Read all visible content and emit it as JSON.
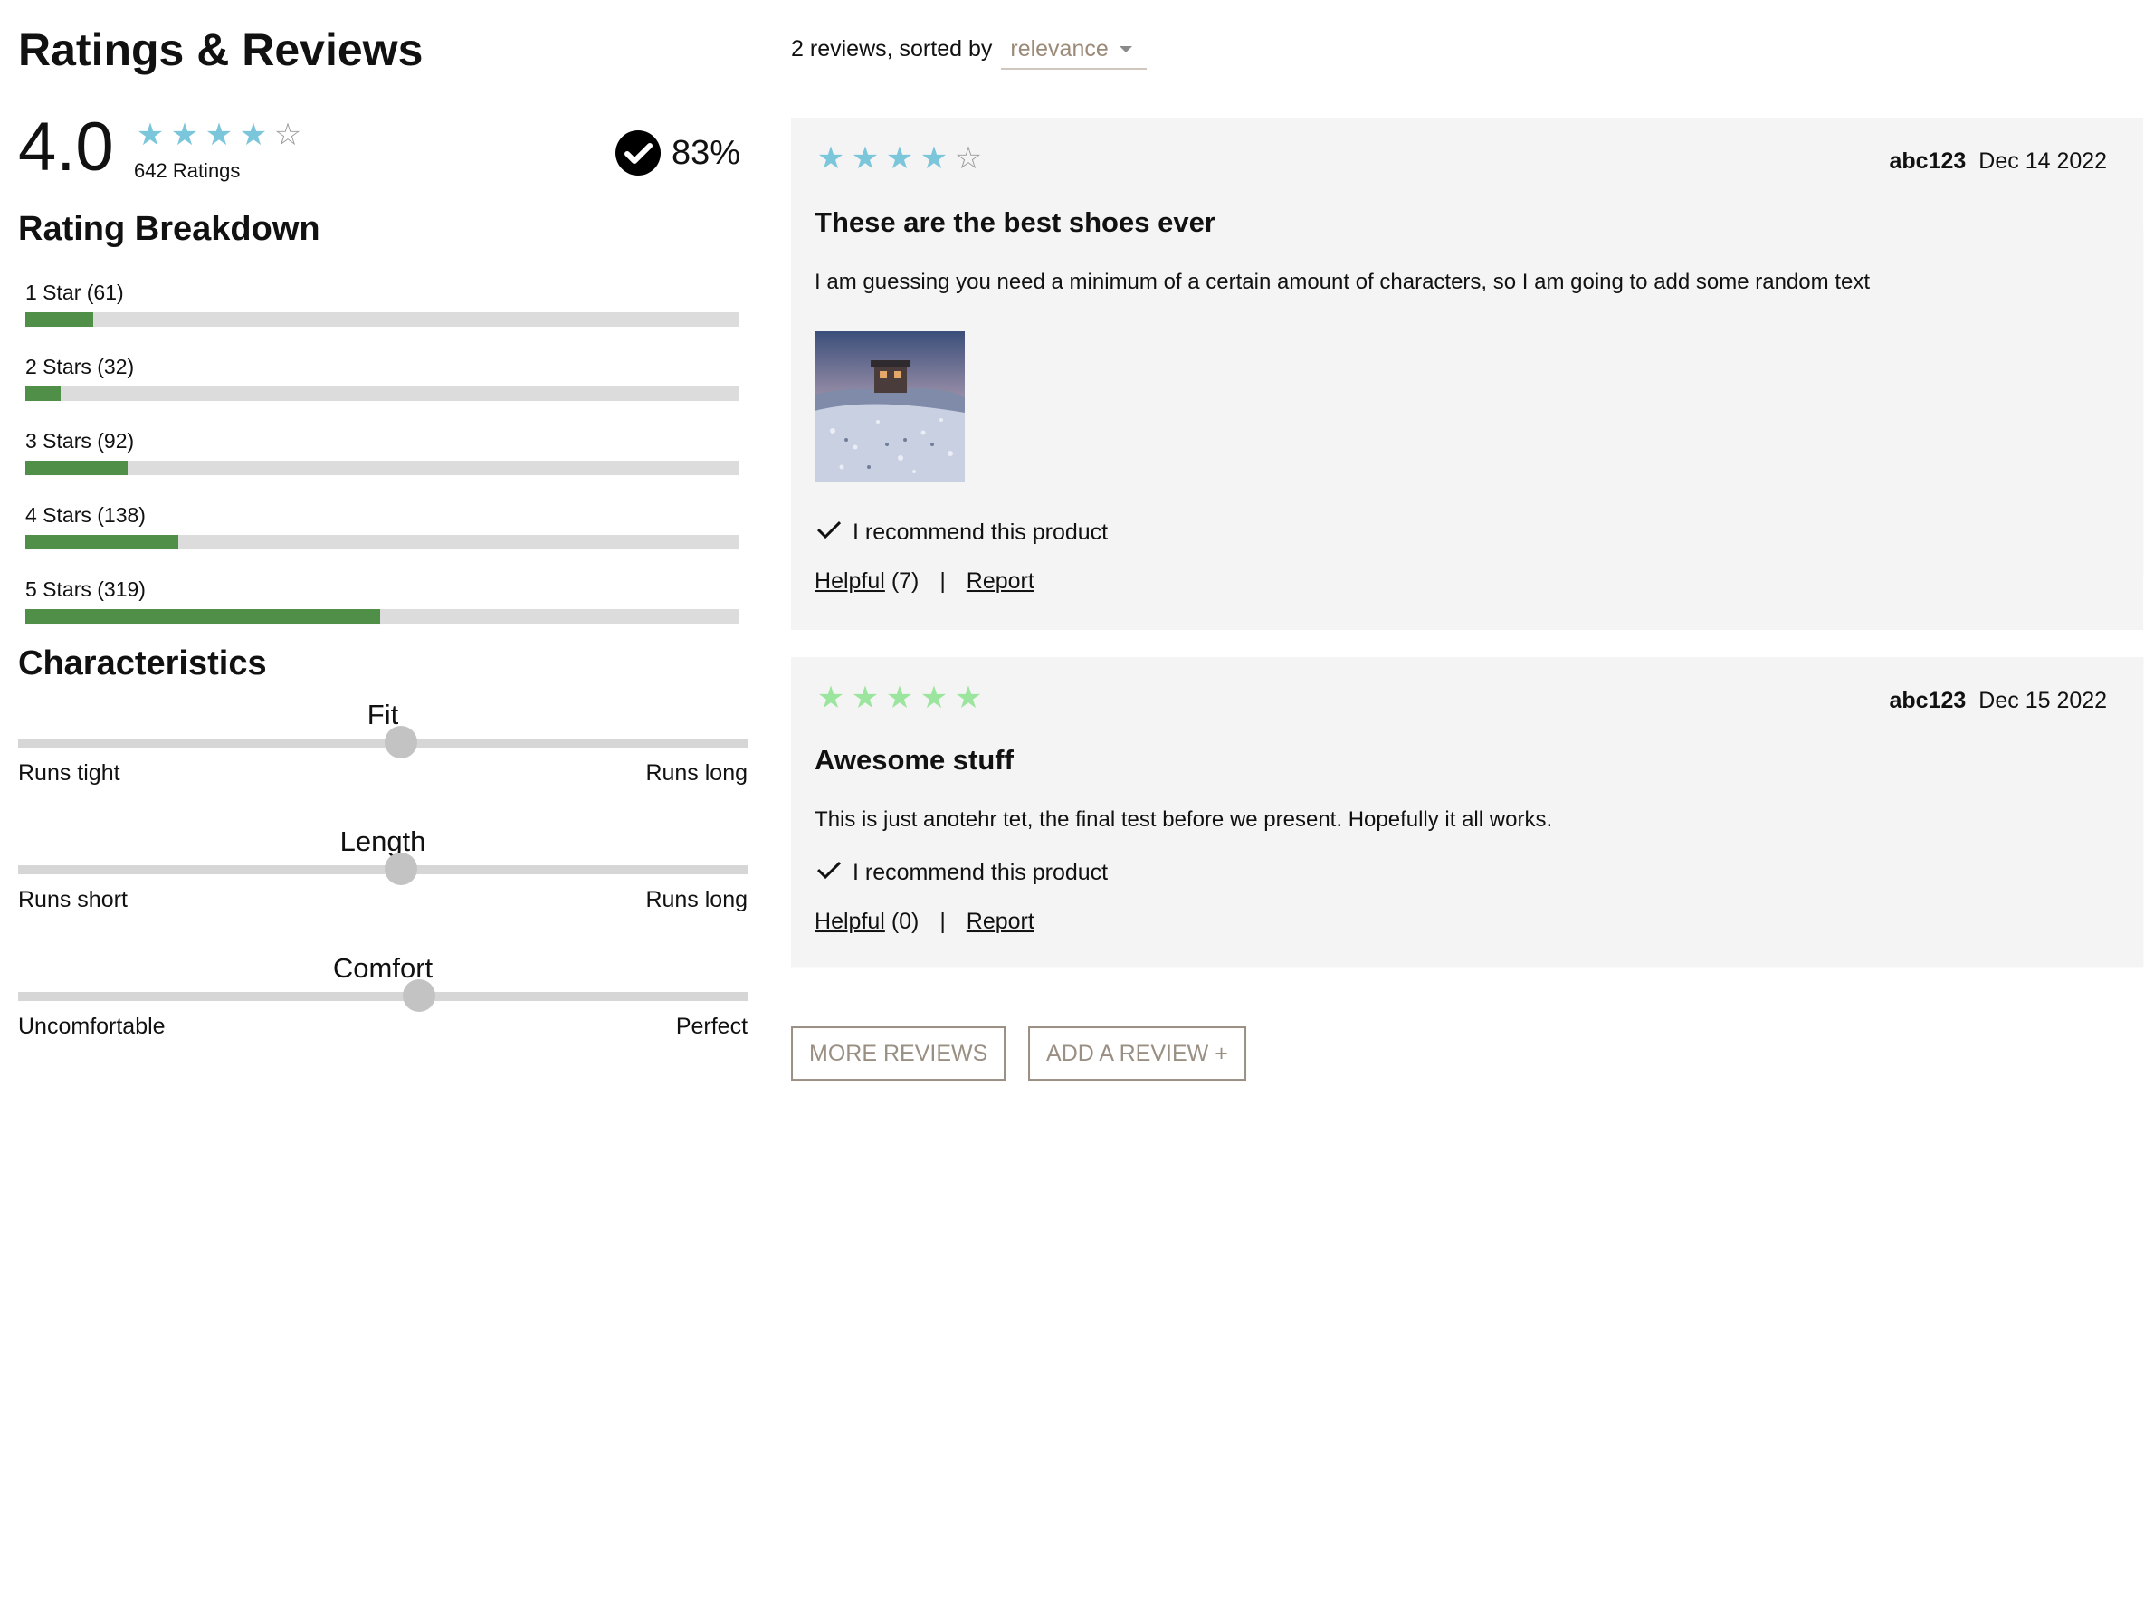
{
  "header": {
    "title": "Ratings & Reviews"
  },
  "summary": {
    "average": "4.0",
    "average_stars": 4,
    "ratings_count": "642 Ratings",
    "recommend_pct": "83%"
  },
  "breakdown": {
    "title": "Rating Breakdown",
    "rows": [
      {
        "label": "1 Star (61)",
        "count": 61
      },
      {
        "label": "2 Stars (32)",
        "count": 32
      },
      {
        "label": "3 Stars (92)",
        "count": 92
      },
      {
        "label": "4 Stars (138)",
        "count": 138
      },
      {
        "label": "5 Stars (319)",
        "count": 319
      }
    ],
    "total": 642
  },
  "characteristics": {
    "title": "Characteristics",
    "items": [
      {
        "name": "Fit",
        "low": "Runs tight",
        "high": "Runs long",
        "value": 0.525
      },
      {
        "name": "Length",
        "low": "Runs short",
        "high": "Runs long",
        "value": 0.525
      },
      {
        "name": "Comfort",
        "low": "Uncomfortable",
        "high": "Perfect",
        "value": 0.55
      }
    ]
  },
  "sort": {
    "prefix": "2 reviews, sorted by",
    "selected": "relevance"
  },
  "reviews": [
    {
      "rating": 4,
      "user": "abc123",
      "date": "Dec 14 2022",
      "summary": "These are the best shoes ever",
      "body": "I am guessing you need a minimum of a certain amount of characters, so I am going to add some random text",
      "recommend": "I recommend this product",
      "helpful_label": "Helpful",
      "helpful_count": "(7)",
      "separator": "|",
      "report_label": "Report"
    },
    {
      "rating": 5,
      "user": "abc123",
      "date": "Dec 15 2022",
      "summary": "Awesome stuff",
      "body": "This is just anotehr tet, the final test before we present. Hopefully it all works.",
      "recommend": "I recommend this product",
      "helpful_label": "Helpful",
      "helpful_count": "(0)",
      "separator": "|",
      "report_label": "Report"
    }
  ],
  "buttons": {
    "more": "MORE REVIEWS",
    "add": "ADD A REVIEW +"
  },
  "colors": {
    "star_blue": "#7cc6dc",
    "star_green": "#9ce59e",
    "bar_fill": "#4f8f47",
    "bar_track": "#dcdcdc",
    "accent_brown": "#9b8a78"
  },
  "icons": {
    "star": "star-icon",
    "recommend_badge": "check-circle-icon",
    "check": "check-icon",
    "caret": "chevron-down-icon"
  }
}
